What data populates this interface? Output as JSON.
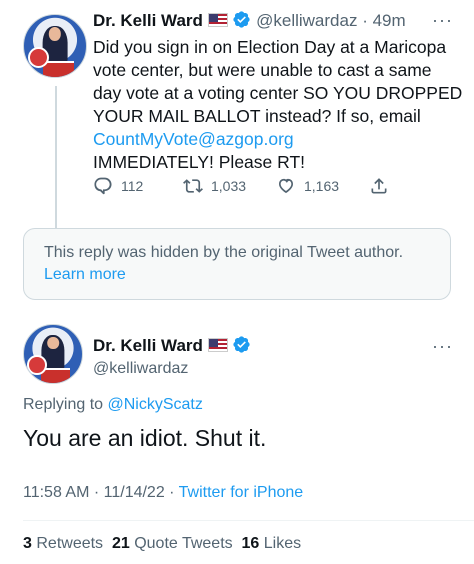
{
  "tweet1": {
    "display_name": "Dr. Kelli Ward",
    "handle": "@kelliwardaz",
    "time": "· 49m",
    "more": "···",
    "text_before_link": "Did you sign in on Election Day at a Maricopa vote center, but were unable to cast a same day vote at a voting center SO YOU DROPPED YOUR MAIL BALLOT instead? If so, email ",
    "email": "CountMyVote@azgop.org",
    "text_after_link": "IMMEDIATELY! Please RT!",
    "replies": "112",
    "retweets": "1,033",
    "likes": "1,163"
  },
  "hidden_notice": {
    "text": "This reply was hidden by the original Tweet author.",
    "link": "Learn more"
  },
  "tweet2": {
    "display_name": "Dr. Kelli Ward",
    "handle": "@kelliwardaz",
    "more": "···",
    "replying_prefix": "Replying to",
    "replying_to": "@NickyScatz",
    "text": "You are an idiot. Shut it.",
    "time": "11:58 AM · 11/14/22 · ",
    "source": "Twitter for iPhone",
    "retweets_count": "3",
    "retweets_label": "Retweets",
    "quotes_count": "21",
    "quotes_label": "Quote Tweets",
    "likes_count": "16",
    "likes_label": "Likes"
  },
  "colors": {
    "accent": "#1d9bf0",
    "text": "#0f1419",
    "muted": "#536471"
  },
  "icons": [
    "reply-icon",
    "retweet-icon",
    "like-icon",
    "share-icon",
    "verified-badge-icon",
    "us-flag-icon",
    "more-icon"
  ]
}
